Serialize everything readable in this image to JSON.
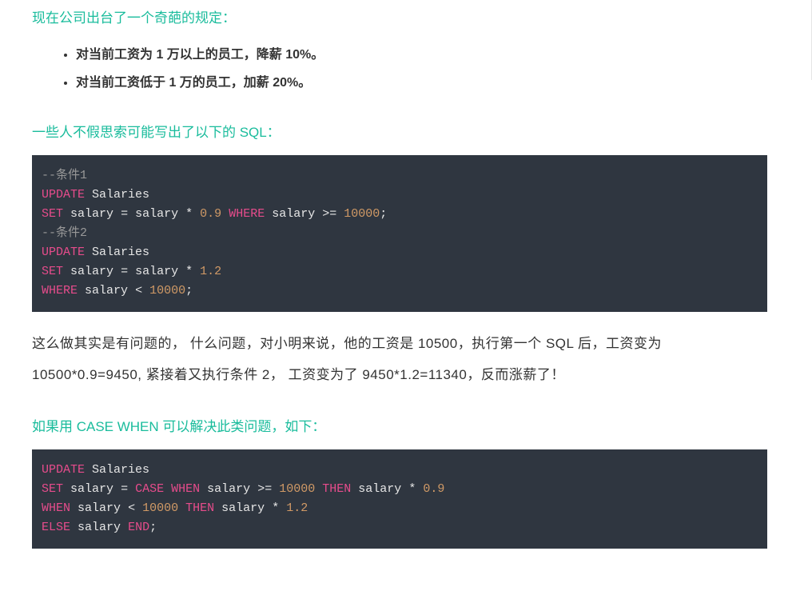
{
  "intro": "现在公司出台了一个奇葩的规定：",
  "bullets": [
    "对当前工资为 1 万以上的员工，降薪 10%。",
    "对当前工资低于 1 万的员工，加薪 20%。"
  ],
  "section1_title": "一些人不假思索可能写出了以下的 SQL：",
  "code1": {
    "c1": "--条件1",
    "l2a": "UPDATE",
    "l2b": "Salaries",
    "l3a": "SET",
    "l3b": "salary",
    "l3c": "=",
    "l3d": "salary",
    "l3e": "*",
    "l3f": "0.9",
    "l3g": "WHERE",
    "l3h": "salary",
    "l3i": ">=",
    "l3j": "10000",
    "l3k": ";",
    "c2": "--条件2",
    "l5a": "UPDATE",
    "l5b": "Salaries",
    "l6a": "SET",
    "l6b": "salary",
    "l6c": "=",
    "l6d": "salary",
    "l6e": "*",
    "l6f": "1.2",
    "l7a": "WHERE",
    "l7b": "salary",
    "l7c": "<",
    "l7d": "10000",
    "l7e": ";"
  },
  "paragraph1": "这么做其实是有问题的， 什么问题，对小明来说，他的工资是 10500，执行第一个 SQL 后，工资变为 10500*0.9=9450, 紧接着又执行条件 2， 工资变为了 9450*1.2=11340，反而涨薪了！",
  "section2_title": "如果用 CASE WHEN 可以解决此类问题，如下：",
  "code2": {
    "l1a": "UPDATE",
    "l1b": "Salaries",
    "l2a": "SET",
    "l2b": "salary",
    "l2c": "=",
    "l2d": "CASE",
    "l2e": "WHEN",
    "l2f": "salary",
    "l2g": ">=",
    "l2h": "10000",
    "l2i": "THEN",
    "l2j": "salary",
    "l2k": "*",
    "l2l": "0.9",
    "l3a": "WHEN",
    "l3b": "salary",
    "l3c": "<",
    "l3d": "10000",
    "l3e": "THEN",
    "l3f": "salary",
    "l3g": "*",
    "l3h": "1.2",
    "l4a": "ELSE",
    "l4b": "salary",
    "l4c": "END",
    "l4d": ";"
  }
}
